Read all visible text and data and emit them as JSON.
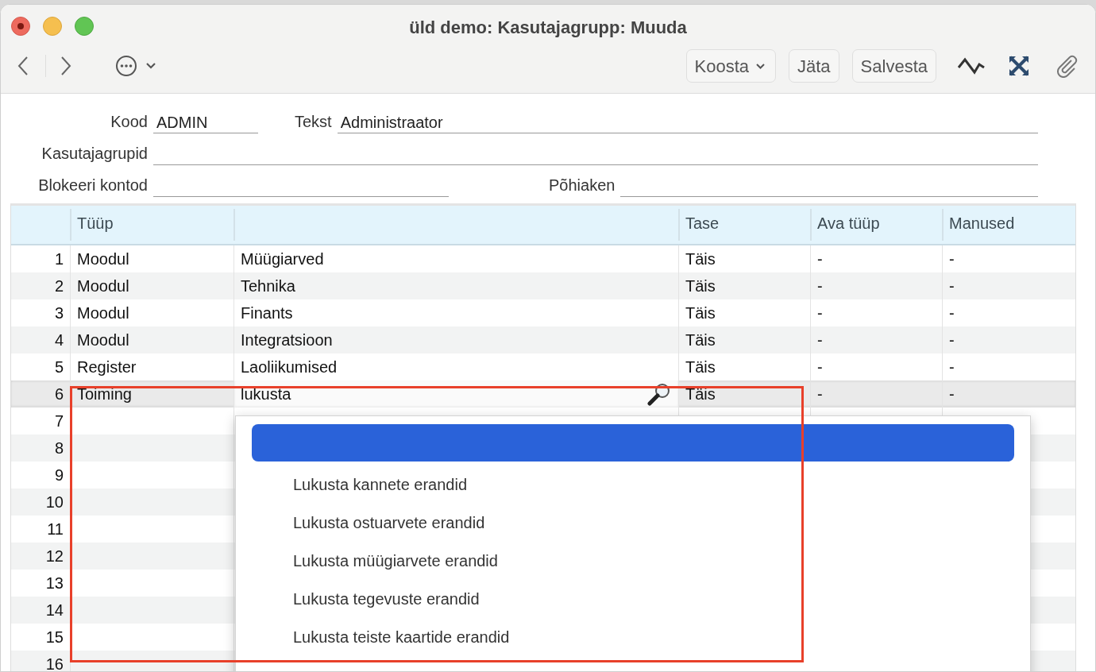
{
  "window": {
    "title": "üld demo: Kasutajagrupp: Muuda"
  },
  "toolbar": {
    "buttons": [
      {
        "label": "Koosta",
        "kind": "menu"
      },
      {
        "label": "Jäta",
        "kind": "plain"
      },
      {
        "label": "Salvesta",
        "kind": "plain"
      }
    ]
  },
  "form": {
    "rows": [
      {
        "fields": [
          {
            "label": "Kood",
            "value": "ADMIN",
            "kind": "short"
          },
          {
            "label": "Tekst",
            "value": "Administraator",
            "kind": "wide"
          }
        ]
      },
      {
        "fields": [
          {
            "label": "Kasutajagrupid",
            "kind": "wide"
          }
        ]
      },
      {
        "fields": [
          {
            "label": "Blokeeri kontod",
            "kind": "medium"
          },
          {
            "label": "Põhiaken",
            "kind": "wide"
          }
        ]
      }
    ]
  },
  "table": {
    "columns": [
      {
        "kind": "index"
      },
      {
        "kind": "text",
        "label": "Tüüp"
      },
      {
        "kind": "text"
      },
      {
        "kind": "text",
        "label": "Tase"
      },
      {
        "kind": "text",
        "label": "Ava tüüp"
      },
      {
        "kind": "text",
        "label": "Manused"
      }
    ],
    "rows": [
      {
        "number": "1",
        "editing": false,
        "cells": [
          "Moodul",
          "Müügiarved",
          "Täis",
          "-",
          "-"
        ]
      },
      {
        "number": "2",
        "editing": false,
        "cells": [
          "Moodul",
          "Tehnika",
          "Täis",
          "-",
          "-"
        ]
      },
      {
        "number": "3",
        "editing": false,
        "cells": [
          "Moodul",
          "Finants",
          "Täis",
          "-",
          "-"
        ]
      },
      {
        "number": "4",
        "editing": false,
        "cells": [
          "Moodul",
          "Integratsioon",
          "Täis",
          "-",
          "-"
        ]
      },
      {
        "number": "5",
        "editing": false,
        "cells": [
          "Register",
          "Laoliikumised",
          "Täis",
          "-",
          "-"
        ]
      },
      {
        "number": "6",
        "editing": true,
        "cells": [
          "Toiming",
          "lukusta",
          "Täis",
          "-",
          "-"
        ]
      },
      {
        "number": "7",
        "editing": false
      },
      {
        "number": "8",
        "editing": false
      },
      {
        "number": "9",
        "editing": false
      },
      {
        "number": "10",
        "editing": false
      },
      {
        "number": "11",
        "editing": false
      },
      {
        "number": "12",
        "editing": false
      },
      {
        "number": "13",
        "editing": false
      },
      {
        "number": "14",
        "editing": false
      },
      {
        "number": "15",
        "editing": false
      },
      {
        "number": "16",
        "editing": false
      }
    ]
  },
  "dropdown": {
    "items": [
      {
        "selected": true
      },
      {
        "label": "Lukusta kannete erandid",
        "selected": false
      },
      {
        "label": "Lukusta ostuarvete erandid",
        "selected": false
      },
      {
        "label": "Lukusta müügiarvete erandid",
        "selected": false
      },
      {
        "label": "Lukusta tegevuste erandid",
        "selected": false
      },
      {
        "label": "Lukusta teiste kaartide erandid",
        "selected": false
      }
    ]
  }
}
